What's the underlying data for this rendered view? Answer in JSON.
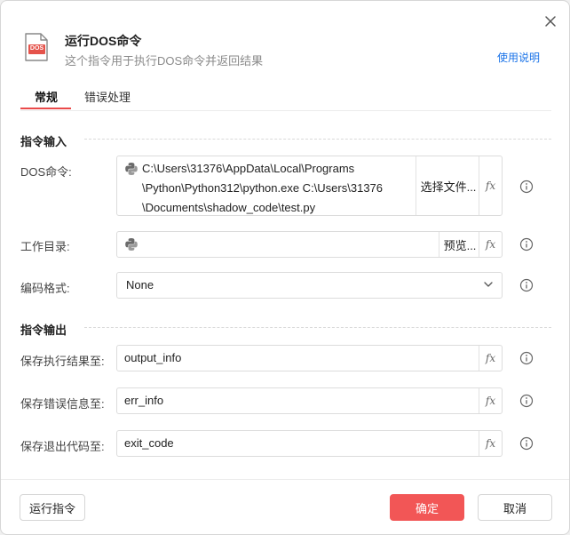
{
  "header": {
    "title": "运行DOS命令",
    "subtitle": "这个指令用于执行DOS命令并返回结果",
    "help_link": "使用说明",
    "icon_text": "DOS"
  },
  "tabs": [
    {
      "label": "常规",
      "active": true
    },
    {
      "label": "错误处理",
      "active": false
    }
  ],
  "input_section": {
    "title": "指令输入",
    "dos_command": {
      "label": "DOS命令:",
      "lines": [
        "C:\\Users\\31376\\AppData\\Local\\Programs",
        "\\Python\\Python312\\python.exe C:\\Users\\31376",
        "\\Documents\\shadow_code\\test.py"
      ],
      "button": "选择文件..."
    },
    "work_dir": {
      "label": "工作目录:",
      "value": "",
      "button": "预览..."
    },
    "encoding": {
      "label": "编码格式:",
      "value": "None"
    }
  },
  "output_section": {
    "title": "指令输出",
    "result": {
      "label": "保存执行结果至:",
      "value": "output_info"
    },
    "error": {
      "label": "保存错误信息至:",
      "value": "err_info"
    },
    "exit_code": {
      "label": "保存退出代码至:",
      "value": "exit_code"
    }
  },
  "fx_label": "fx",
  "footer": {
    "run": "运行指令",
    "ok": "确定",
    "cancel": "取消"
  },
  "colors": {
    "accent": "#f25656",
    "link": "#1a73e8",
    "tab_underline": "#ea4a4a"
  },
  "icons": [
    "close-icon",
    "dos-file-icon",
    "python-icon",
    "fx-icon",
    "info-icon",
    "chevron-down-icon"
  ]
}
